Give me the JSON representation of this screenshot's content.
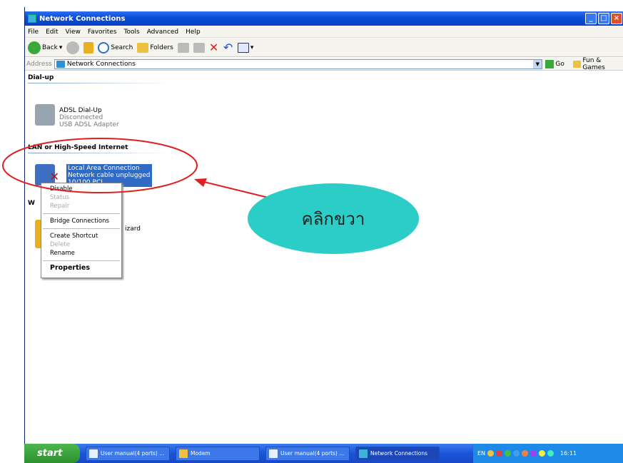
{
  "window": {
    "title": "Network Connections",
    "min": "_",
    "max": "□",
    "close": "×"
  },
  "menu": [
    "File",
    "Edit",
    "View",
    "Favorites",
    "Tools",
    "Advanced",
    "Help"
  ],
  "toolbar": {
    "back": "Back",
    "search": "Search",
    "folders": "Folders",
    "views_arrow": "▾",
    "back_arrow": "▾"
  },
  "address": {
    "label": "Address",
    "value": "Network Connections",
    "go": "Go",
    "links": "Fun & Games"
  },
  "groups": {
    "dialup": "Dial-up",
    "lan": "LAN or High-Speed Internet",
    "wizard_hdr": "W"
  },
  "dialup_conn": {
    "name": "ADSL Dial-Up",
    "status": "Disconnected",
    "device": "USB ADSL Adapter"
  },
  "lan_conn": {
    "name": "Local Area Connection",
    "status": "Network cable unplugged",
    "device": "10/100 PCI..."
  },
  "wizard": {
    "label": "izard"
  },
  "context_menu": {
    "disable": "Disable",
    "status": "Status",
    "repair": "Repair",
    "bridge": "Bridge Connections",
    "shortcut": "Create Shortcut",
    "delete": "Delete",
    "rename": "Rename",
    "properties": "Properties"
  },
  "annotation": {
    "text": "คลิกขวา",
    "color": "#2ccdc6",
    "arrow_color": "#e02020"
  },
  "taskbar": {
    "start": "start",
    "tasks": [
      "User manual(4 ports) ...",
      "Modem",
      "User manual(4 ports) ...",
      "Network Connections"
    ],
    "lang": "EN",
    "clock": "16:11"
  }
}
